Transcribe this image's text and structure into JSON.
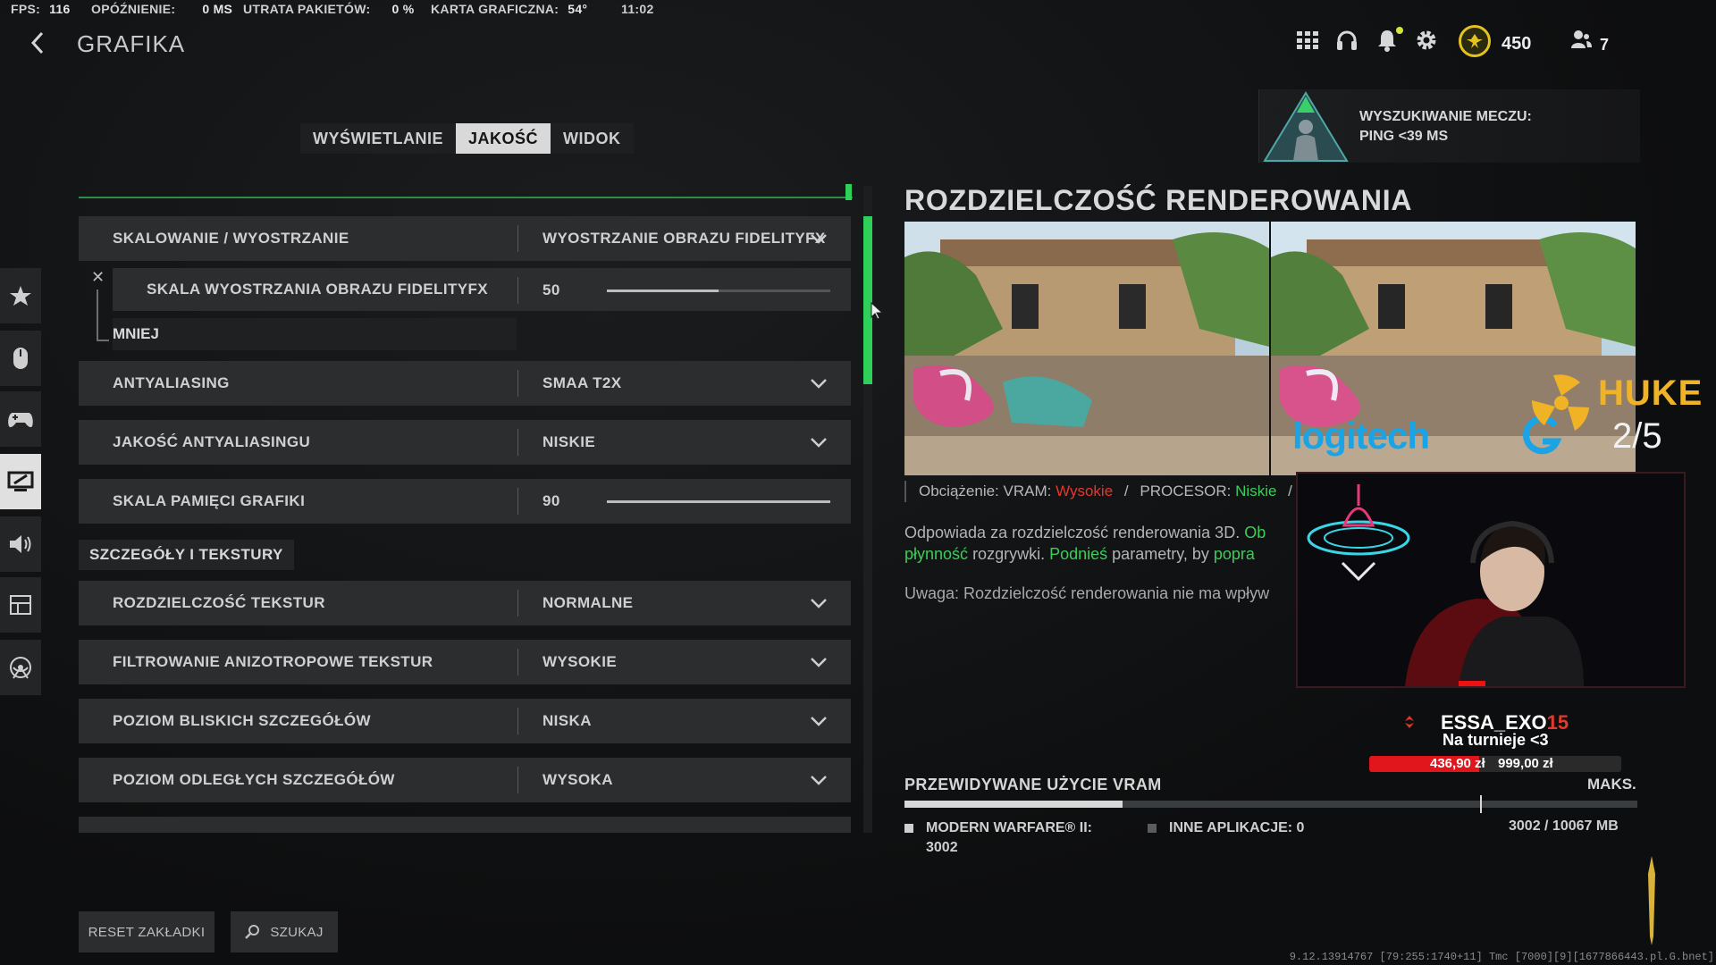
{
  "stats": {
    "fps_label": "FPS:",
    "fps_value": "116",
    "latency_label": "OPÓŹNIENIE:",
    "latency_value": "0 MS",
    "loss_label": "UTRATA PAKIETÓW:",
    "loss_value": "0 %",
    "gpu_label": "KARTA GRAFICZNA:",
    "gpu_value": "54°",
    "clock": "11:02"
  },
  "header": {
    "title": "GRAFIKA",
    "cp_amount": "450",
    "friends_count": "7"
  },
  "matchmaking": {
    "line1": "WYSZUKIWANIE MECZU:",
    "line2": "PING <39 MS"
  },
  "tabs": [
    {
      "label": "WYŚWIETLANIE",
      "active": false
    },
    {
      "label": "JAKOŚĆ",
      "active": true
    },
    {
      "label": "WIDOK",
      "active": false
    }
  ],
  "settings": {
    "upscaling": {
      "label": "SKALOWANIE / WYOSTRZANIE",
      "value": "WYOSTRZANIE OBRAZU FIDELITYFX"
    },
    "sharpness": {
      "label": "SKALA WYOSTRZANIA OBRAZU FIDELITYFX",
      "value": "50",
      "fraction": 0.5
    },
    "less_label": "MNIEJ",
    "antialiasing": {
      "label": "ANTYALIASING",
      "value": "SMAA T2X"
    },
    "aa_quality": {
      "label": "JAKOŚĆ ANTYALIASINGU",
      "value": "NISKIE"
    },
    "vram_scale": {
      "label": "SKALA PAMIĘCI GRAFIKI",
      "value": "90",
      "fraction": 1.0
    },
    "section_details": "SZCZEGÓŁY I TEKSTURY",
    "texture_res": {
      "label": "ROZDZIELCZOŚĆ TEKSTUR",
      "value": "NORMALNE"
    },
    "aniso": {
      "label": "FILTROWANIE ANIZOTROPOWE TEKSTUR",
      "value": "WYSOKIE"
    },
    "near_detail": {
      "label": "POZIOM BLISKICH SZCZEGÓŁÓW",
      "value": "NISKA"
    },
    "far_detail": {
      "label": "POZIOM ODLEGŁYCH SZCZEGÓŁÓW",
      "value": "WYSOKA"
    }
  },
  "detail": {
    "title": "ROZDZIELCZOŚĆ RENDEROWANIA",
    "load_prefix": "Obciążenie: VRAM:",
    "load_vram": "Wysokie",
    "sep": "/",
    "load_cpu_label": "PROCESOR:",
    "load_cpu": "Niskie",
    "desc_line1_a": "Odpowiada za rozdzielczość renderowania 3D.",
    "desc_line1_b": "Ob",
    "desc_line2_a": "płynność",
    "desc_line2_b": "rozgrywki.",
    "desc_line2_c": "Podnieś",
    "desc_line2_d": "parametry, by",
    "desc_line2_e": "popra",
    "note": "Uwaga: Rozdzielczość renderowania nie ma wpływ"
  },
  "stream_overlay": {
    "sponsor": "logitech",
    "brand": "HUKE",
    "counter": "2/5",
    "donor_name": "ESSA_EXO",
    "donor_number": "15",
    "donor_message": "Na turnieje <3",
    "donation_current": "436,90 zł",
    "donation_goal": "999,00 zł",
    "donation_fraction": 0.437
  },
  "vram": {
    "title": "PRZEWIDYWANE UŻYCIE VRAM",
    "max_label": "MAKS.",
    "usage_fraction": 0.298,
    "max_fraction": 0.785,
    "game_label": "MODERN WARFARE® II:",
    "game_value": "3002",
    "other_label": "INNE APLIKACJE: 0",
    "total": "3002 / 10067 MB",
    "game_color": "#cfcfcf",
    "other_color": "#5a5d60"
  },
  "buttons": {
    "reset": "RESET ZAKŁADKI",
    "search": "SZUKAJ"
  },
  "build_info": "9.12.13914767 [79:255:1740+11] Tmc [7000][9][1677866443.pl.G.bnet]",
  "colors": {
    "accent_green": "#2ed05a",
    "warning_red": "#e3382d",
    "cp_gold": "#e4c321"
  }
}
